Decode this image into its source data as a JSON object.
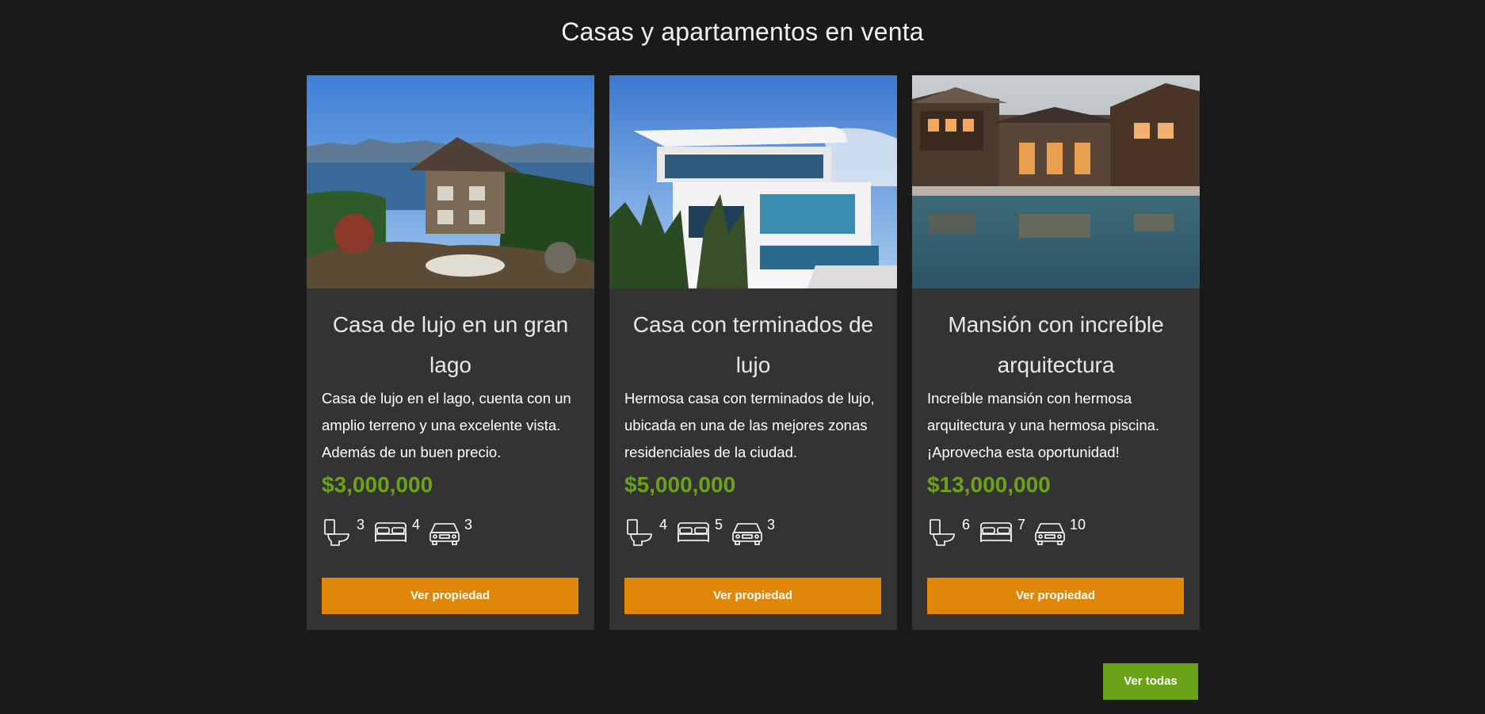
{
  "section": {
    "title": "Casas y apartamentos en venta"
  },
  "listings": [
    {
      "image": "lake-house-photo",
      "title": "Casa de lujo en un gran lago",
      "description": "Casa de lujo en el lago, cuenta con un amplio terreno y una excelente vista. Además de un buen precio.",
      "price": "$3,000,000",
      "bathrooms": "3",
      "bedrooms": "4",
      "parking": "3",
      "button_label": "Ver propiedad"
    },
    {
      "image": "modern-house-photo",
      "title": "Casa con terminados de lujo",
      "description": "Hermosa casa con terminados de lujo, ubicada en una de las mejores zonas residenciales de la ciudad.",
      "price": "$5,000,000",
      "bathrooms": "4",
      "bedrooms": "5",
      "parking": "3",
      "button_label": "Ver propiedad"
    },
    {
      "image": "mansion-pool-photo",
      "title": "Mansión con increíble arquitectura",
      "description": "Increíble mansión con hermosa arquitectura y una hermosa piscina. ¡Aprovecha esta oportunidad!",
      "price": "$13,000,000",
      "bathrooms": "6",
      "bedrooms": "7",
      "parking": "10",
      "button_label": "Ver propiedad"
    }
  ],
  "footer": {
    "view_all_label": "Ver todas"
  },
  "colors": {
    "background": "#1a1a1a",
    "card": "#333333",
    "price": "#6aa317",
    "button_orange": "#e08709",
    "button_green": "#6aa317"
  },
  "icons": [
    "toilet-icon",
    "bed-icon",
    "car-icon"
  ]
}
